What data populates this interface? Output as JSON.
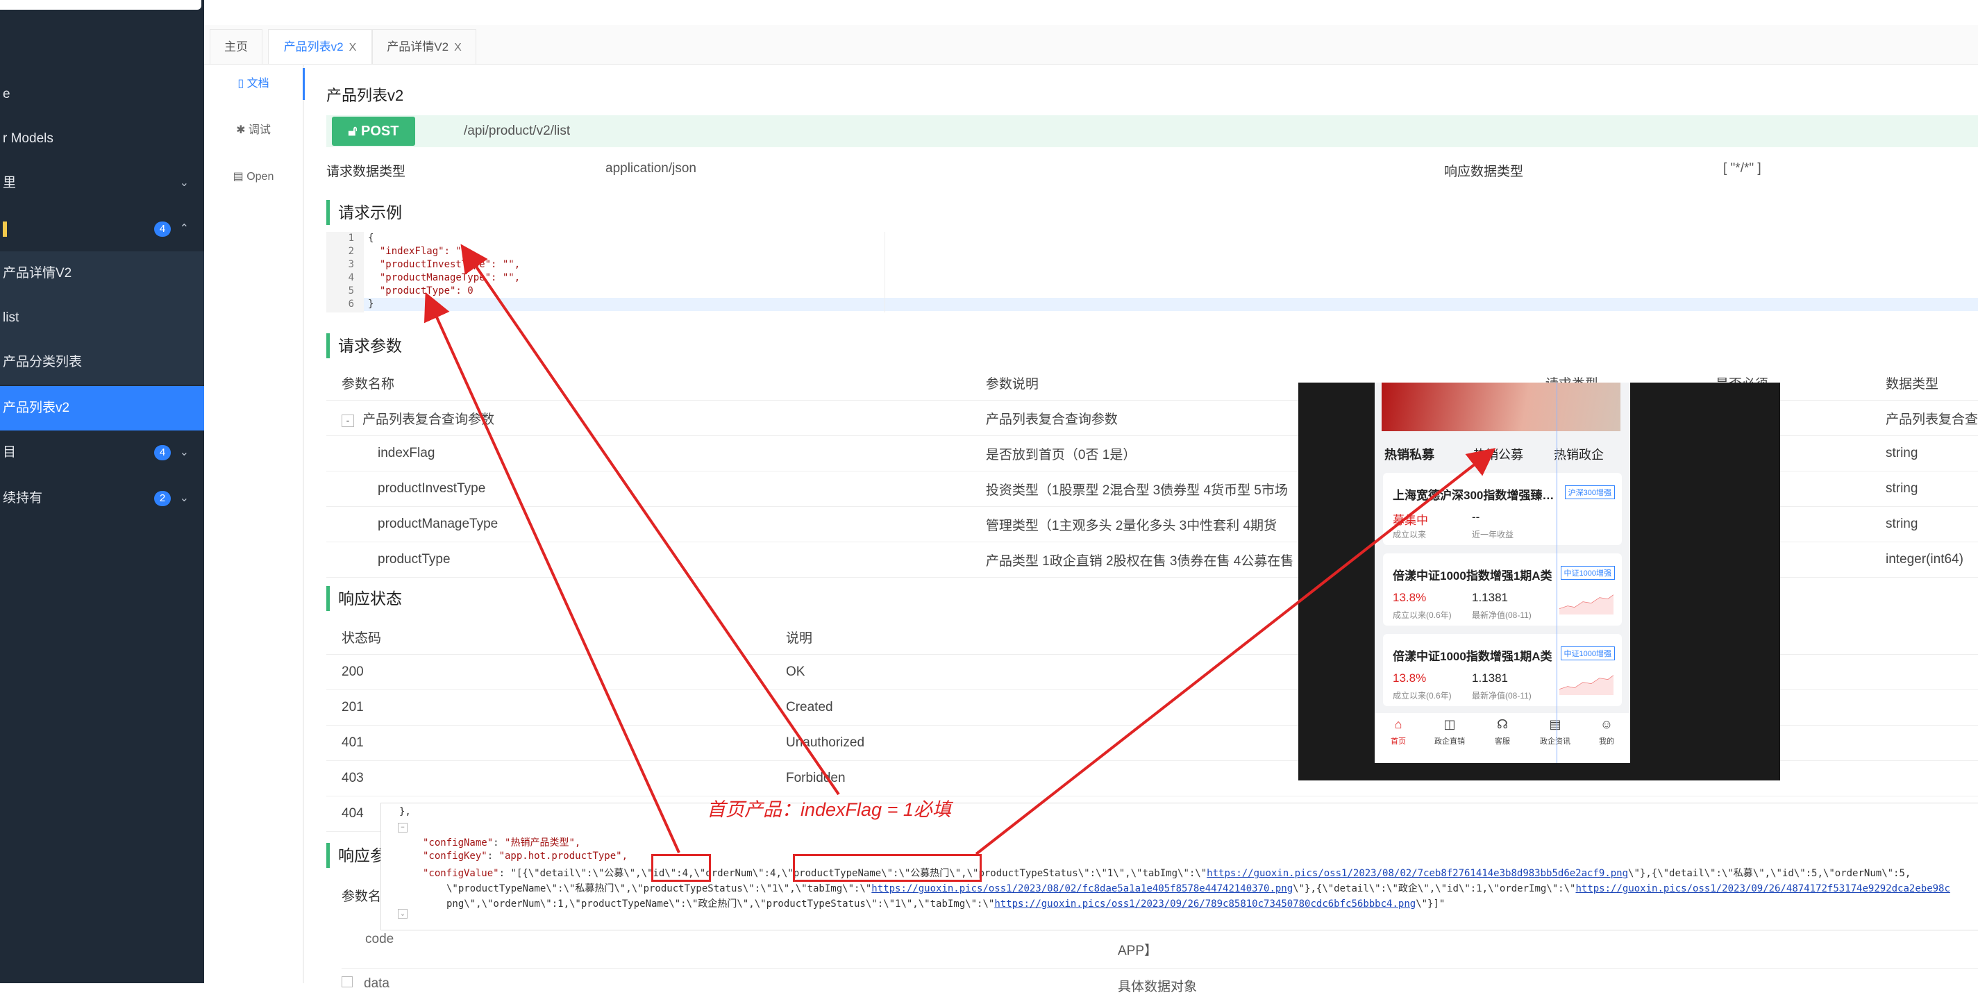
{
  "sidebar": {
    "items": [
      {
        "label": "e",
        "sub": false
      },
      {
        "label": "r Models",
        "sub": false
      },
      {
        "label": "里",
        "sub": false,
        "arrow": "⌄"
      },
      {
        "label": "",
        "sub": false,
        "badge": "4",
        "arrow": "⌃"
      },
      {
        "label": "产品详情V2",
        "sub": true
      },
      {
        "label": "list",
        "sub": true
      },
      {
        "label": "产品分类列表",
        "sub": true
      },
      {
        "label": "产品列表v2",
        "sub": true,
        "active": true
      },
      {
        "label": "目",
        "sub": false,
        "badge": "4",
        "arrow": "⌄"
      },
      {
        "label": "续持有",
        "sub": false,
        "badge": "2",
        "arrow": "⌄"
      }
    ]
  },
  "tabs": [
    {
      "label": "主页"
    },
    {
      "label": "产品列表v2",
      "close": "X"
    },
    {
      "label": "产品详情V2",
      "close": "X"
    }
  ],
  "left_nav": [
    {
      "label": "文档"
    },
    {
      "label": "调试"
    },
    {
      "label": "Open"
    }
  ],
  "doc": {
    "title": "产品列表v2",
    "method": "POST",
    "path": "/api/product/v2/list",
    "req_type_label": "请求数据类型",
    "req_type_value": "application/json",
    "resp_type_label": "响应数据类型",
    "resp_type_value": "[ \"*/*\" ]",
    "sec_req_example": "请求示例",
    "sec_req_params": "请求参数",
    "sec_resp_status": "响应状态",
    "sec_resp_params": "响应参"
  },
  "code_example": {
    "line_numbers": [
      "1",
      "2",
      "3",
      "4",
      "5",
      "6"
    ],
    "lines": [
      "{",
      "  \"indexFlag\": \"\",",
      "  \"productInvestType\": \"\",",
      "  \"productManageType\": \"\",",
      "  \"productType\": 0",
      "}"
    ]
  },
  "params_table": {
    "headers": [
      "参数名称",
      "参数说明",
      "请求类型",
      "是否必须",
      "数据类型"
    ],
    "rows": [
      {
        "name": "产品列表复合查询参数",
        "desc": "产品列表复合查询参数",
        "type": "产品列表复合查",
        "toggle": "-"
      },
      {
        "name": "indexFlag",
        "desc": "是否放到首页（0否 1是）",
        "type": "string"
      },
      {
        "name": "productInvestType",
        "desc": "投资类型（1股票型 2混合型 3债券型 4货币型 5市场",
        "type": "string"
      },
      {
        "name": "productManageType",
        "desc": "管理类型（1主观多头 2量化多头 3中性套利 4期货",
        "type": "string"
      },
      {
        "name": "productType",
        "desc": "产品类型 1政企直销 2股权在售 3债券在售 4公募在售",
        "type": "integer(int64)"
      }
    ]
  },
  "status_table": {
    "headers": [
      "状态码",
      "说明"
    ],
    "rows": [
      {
        "code": "200",
        "desc": "OK"
      },
      {
        "code": "201",
        "desc": "Created"
      },
      {
        "code": "401",
        "desc": "Unauthorized"
      },
      {
        "code": "403",
        "desc": "Forbidden"
      },
      {
        "code": "404",
        "desc": ""
      }
    ]
  },
  "resp_params": {
    "header": "参数名",
    "row1": "code",
    "row1_desc": "APP】",
    "row2": "data",
    "row2_desc": "具体数据对象"
  },
  "phone": {
    "tabs": [
      "热销私募",
      "热销公募",
      "热销政企"
    ],
    "cards": [
      {
        "name": "上海宽德沪深300指数增强臻…",
        "tag": "沪深300增强",
        "v1": "募集中",
        "v2": "--",
        "l1": "成立以来",
        "l2": "近一年收益"
      },
      {
        "name": "倍漾中证1000指数增强1期A类",
        "tag": "中证1000增强",
        "v1": "13.8%",
        "v2": "1.1381",
        "l1": "成立以来(0.6年)",
        "l2": "最新净值(08-11)"
      },
      {
        "name": "倍漾中证1000指数增强1期A类",
        "tag": "中证1000增强",
        "v1": "13.8%",
        "v2": "1.1381",
        "l1": "成立以来(0.6年)",
        "l2": "最新净值(08-11)"
      }
    ],
    "nav": [
      "首页",
      "政企直销",
      "客服",
      "政企资讯",
      "我的"
    ],
    "nav_icons": [
      "home-icon",
      "chart-icon",
      "headset-icon",
      "news-icon",
      "user-icon"
    ]
  },
  "json_snippet": {
    "l0": "},",
    "l1_key": "\"configName\"",
    "l1_val": "\"热销产品类型\",",
    "l2_key": "\"configKey\"",
    "l2_val": "\"app.hot.productType\",",
    "l3_key": "\"configValue\"",
    "l3_a": "\"[{\\\"detail\\\":\\\"公募\\\",\\\"id\\\":4,\\\"orderNum\\\":4,\\\"productTypeName\\\":\\\"公募热门\\\",\\\"productTypeStatus\\\":\\\"1\\\",\\\"tabImg\\\":\\\"",
    "l3_url": "https://guoxin.pics/oss1/2023/08/02/7ceb8f2761414e3b8d983bb5d6e2acf9.png",
    "l3_b": "\\\"},{\\\"detail\\\":\\\"私募\\\",\\\"id\\\":5,\\\"orderNum\\\":5,",
    "l4_a": "\\\"productTypeName\\\":\\\"私募热门\\\",\\\"productTypeStatus\\\":\\\"1\\\",\\\"tabImg\\\":\\\"",
    "l4_url": "https://guoxin.pics/oss1/2023/08/02/fc8dae5a1a1e405f8578e44742140370.png",
    "l4_b": "\\\"},{\\\"detail\\\":\\\"政企\\\",\\\"id\\\":1,\\\"orderImg\\\":\\\"",
    "l4_url2": "https://guoxin.pics/oss1/2023/09/26/4874172f53174e9292dca2ebe98c",
    "l5_a": "png\\\",\\\"orderNum\\\":1,\\\"productTypeName\\\":\\\"政企热门\\\",\\\"productTypeStatus\\\":\\\"1\\\",\\\"tabImg\\\":\\\"",
    "l5_url": "https://guoxin.pics/oss1/2023/09/26/789c85810c73450780cdc6bfc56bbbc4.png",
    "l5_b": "\\\"}]\""
  },
  "annotation": "首页产品：indexFlag = 1必填",
  "colors": {
    "accent": "#2f82ff",
    "post": "#3ab878",
    "annotation": "#e02424",
    "sidebar": "#1f2a37"
  }
}
